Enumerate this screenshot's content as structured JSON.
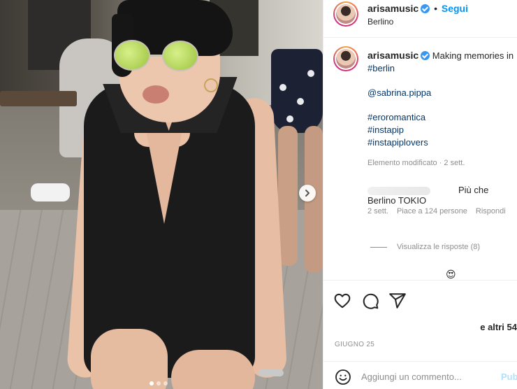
{
  "post": {
    "username": "arisamusic",
    "follow_label": "Segui",
    "separator": "•",
    "location": "Berlino"
  },
  "caption": {
    "username": "arisamusic",
    "text": "Making memories in",
    "tag_berlin": "#berlin",
    "mention": "@sabrina.pippa",
    "tag_1": "#eroromantica",
    "tag_2": "#instapip",
    "tag_3": "#instapiplovers",
    "edited_meta": "Elemento modificato · 2 sett."
  },
  "comment": {
    "text": "Più che Berlino TOKIO",
    "time": "2 sett.",
    "likes": "Piace a 124 persone",
    "reply_label": "Rispondi",
    "view_replies": "Visualizza le risposte (8)",
    "emoji": "😍"
  },
  "actions": {
    "icons": [
      "heart-icon",
      "comment-icon",
      "share-icon"
    ]
  },
  "likes_text": "e altri 54",
  "date": "GIUGNO 25",
  "add_comment": {
    "placeholder": "Aggiungi un commento...",
    "publish_label": "Pubblica"
  },
  "carousel": {
    "total_slides": 3,
    "current_slide": 1
  },
  "colors": {
    "link_blue": "#0095f6",
    "hashtag": "#00376b",
    "muted": "#8e8e8e",
    "verified": "#3897f0"
  }
}
